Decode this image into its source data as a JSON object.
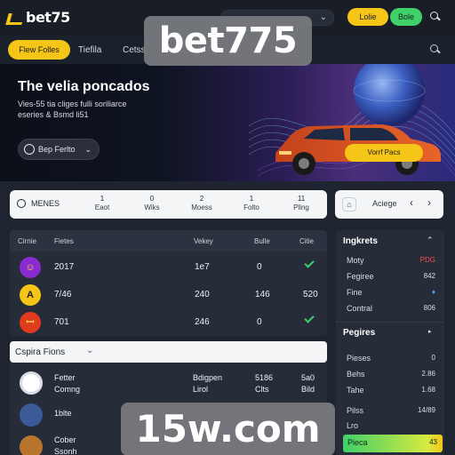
{
  "brand": {
    "logo_text": "bet75",
    "accent_yellow": "#f5c518",
    "accent_green": "#3fd06a"
  },
  "topbar": {
    "login_label": "Lolie",
    "join_label": "Bole",
    "search_chevron": "⌄"
  },
  "subnav": {
    "tabs": [
      "Flew Folles",
      "Tiefila",
      "Cetss"
    ]
  },
  "watermarks": {
    "top": "bet775",
    "bottom": "15w.com"
  },
  "hero": {
    "title": "The velia poncados",
    "line1": "Vies-55 tia cliges fulli soriliarce",
    "line2": "eseries & Bsmd li51",
    "button_label": "Bep Ferlto",
    "cta_label": "Vorrf Pacs"
  },
  "categories": {
    "menus_label": "MENES",
    "items": [
      {
        "icon": "1",
        "label": "Eaot"
      },
      {
        "icon": "0",
        "label": "Wiks"
      },
      {
        "icon": "2",
        "label": "Moess"
      },
      {
        "icon": "1",
        "label": "Folto"
      },
      {
        "icon": "11",
        "label": "Pling"
      }
    ],
    "side": {
      "home": "⌂",
      "label": "Aciege",
      "prev": "‹",
      "next": "›"
    }
  },
  "matches": {
    "headers": [
      "Cirnie",
      "Fietes",
      "Vekey",
      "Bulle",
      "Citie"
    ],
    "rows": [
      {
        "badge": "☺",
        "year": "2017",
        "c2": "1e7",
        "c3": "0"
      },
      {
        "badge": "A",
        "year": "7/46",
        "c2": "240",
        "c3": "146",
        "c4": "520"
      },
      {
        "badge": "ꟷ",
        "year": "701",
        "c2": "246",
        "c3": "0"
      }
    ]
  },
  "section2": {
    "title": "Cspira Fions",
    "chevron": "⌄",
    "rows": [
      {
        "c1a": "Fetter",
        "c1b": "Comng",
        "c2a": "Bdigpen",
        "c2b": "Lirol",
        "c3a": "5186",
        "c3b": "Clts",
        "c4a": "5a0",
        "c4b": "Bild"
      },
      {
        "c1a": "1blte",
        "c2a": "",
        "c3a": "",
        "c4a": ""
      },
      {
        "c1a": "Cober",
        "c1b": "Ssonh"
      }
    ]
  },
  "right_panel": {
    "head1": "Ingkrets",
    "caret1": "⌃",
    "rows1": [
      {
        "label": "Moty",
        "value": "PDG"
      },
      {
        "label": "Fegiree",
        "value": "842"
      },
      {
        "label": "Fine",
        "value": "♦"
      },
      {
        "label": "Contral",
        "value": "806"
      }
    ],
    "head2": "Pegires",
    "caret2": "▸",
    "rows2": [
      {
        "label": "Pieses",
        "value": "0"
      },
      {
        "label": "Behs",
        "value": "2.86"
      },
      {
        "label": "Tahe",
        "value": "1.68"
      },
      {
        "label": "Pilss",
        "value": "14/89"
      },
      {
        "label": "Lro",
        "value": ""
      }
    ],
    "green_row": {
      "label": "Pieca",
      "value": "43"
    }
  }
}
